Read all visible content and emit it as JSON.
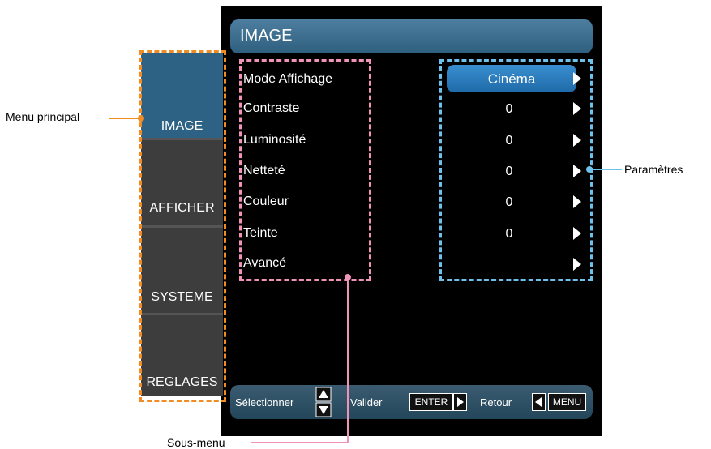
{
  "osd": {
    "title": "IMAGE",
    "sidebar": [
      {
        "label": "IMAGE"
      },
      {
        "label": "AFFICHER"
      },
      {
        "label": "SYSTEME"
      },
      {
        "label": "REGLAGES"
      }
    ],
    "submenu": [
      {
        "label": "Mode Affichage",
        "value": "Cinéma"
      },
      {
        "label": "Contraste",
        "value": "0"
      },
      {
        "label": "Luminosité",
        "value": "0"
      },
      {
        "label": "Netteté",
        "value": "0"
      },
      {
        "label": "Couleur",
        "value": "0"
      },
      {
        "label": "Teinte",
        "value": "0"
      },
      {
        "label": "Avancé",
        "value": ""
      }
    ],
    "footer": {
      "select_label": "Sélectionner",
      "validate_label": "Valider",
      "enter_key": "ENTER",
      "return_label": "Retour",
      "menu_key": "MENU"
    }
  },
  "annotations": {
    "main_menu": "Menu principal",
    "parameters": "Paramètres",
    "submenu": "Sous-menu"
  },
  "colors": {
    "main_menu_marker": "#f08c21",
    "submenu_marker": "#f193b8",
    "parameters_marker": "#6dc1ea",
    "active_value": "#2b7bbf"
  }
}
